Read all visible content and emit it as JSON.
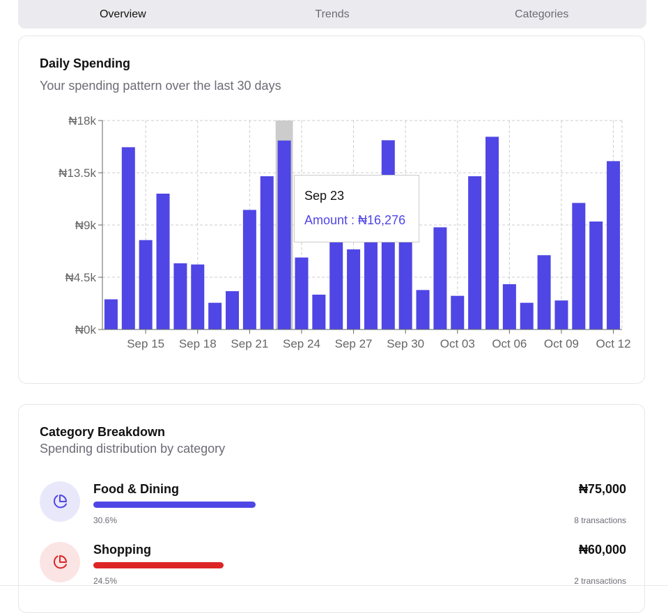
{
  "tabs": [
    {
      "label": "Overview",
      "active": true
    },
    {
      "label": "Trends",
      "active": false
    },
    {
      "label": "Categories",
      "active": false
    }
  ],
  "daily": {
    "title": "Daily Spending",
    "subtitle": "Your spending pattern over the last 30 days"
  },
  "chart_data": {
    "type": "bar",
    "title": "Daily Spending",
    "xlabel": "",
    "ylabel": "",
    "ylim": [
      0,
      18000
    ],
    "y_ticks": [
      "₦0k",
      "₦4.5k",
      "₦9k",
      "₦13.5k",
      "₦18k"
    ],
    "x_ticks": [
      "Sep 15",
      "Sep 18",
      "Sep 21",
      "Sep 24",
      "Sep 27",
      "Sep 30",
      "Oct 03",
      "Oct 06",
      "Oct 09",
      "Oct 12"
    ],
    "grid": true,
    "color": "#4f46e5",
    "categories": [
      "Sep 13",
      "Sep 14",
      "Sep 15",
      "Sep 16",
      "Sep 17",
      "Sep 18",
      "Sep 19",
      "Sep 20",
      "Sep 21",
      "Sep 22",
      "Sep 23",
      "Sep 24",
      "Sep 25",
      "Sep 26",
      "Sep 27",
      "Sep 28",
      "Sep 29",
      "Sep 30",
      "Oct 01",
      "Oct 02",
      "Oct 03",
      "Oct 04",
      "Oct 05",
      "Oct 06",
      "Oct 07",
      "Oct 08",
      "Oct 09",
      "Oct 10",
      "Oct 11",
      "Oct 12"
    ],
    "values": [
      2600,
      15700,
      7700,
      11700,
      5700,
      5600,
      2300,
      3300,
      10300,
      13200,
      16276,
      6200,
      3000,
      7600,
      6900,
      7600,
      16300,
      7600,
      3400,
      8800,
      2900,
      13200,
      16600,
      3900,
      2300,
      6400,
      2500,
      10900,
      9300,
      14500
    ],
    "highlight_index": 10
  },
  "tooltip": {
    "date": "Sep 23",
    "amount": "Amount : ₦16,276"
  },
  "breakdown": {
    "title": "Category Breakdown",
    "subtitle": "Spending distribution by category",
    "items": [
      {
        "name": "Food & Dining",
        "amount": "₦75,000",
        "percent": "30.6%",
        "share": 30.6,
        "transactions": "8 transactions",
        "color": "#4f46e5",
        "bg": "#e9e8fb",
        "icon": "pie-chart-icon"
      },
      {
        "name": "Shopping",
        "amount": "₦60,000",
        "percent": "24.5%",
        "share": 24.5,
        "transactions": "2 transactions",
        "color": "#dc2626",
        "bg": "#fbe4e4",
        "icon": "pie-chart-icon"
      }
    ]
  }
}
